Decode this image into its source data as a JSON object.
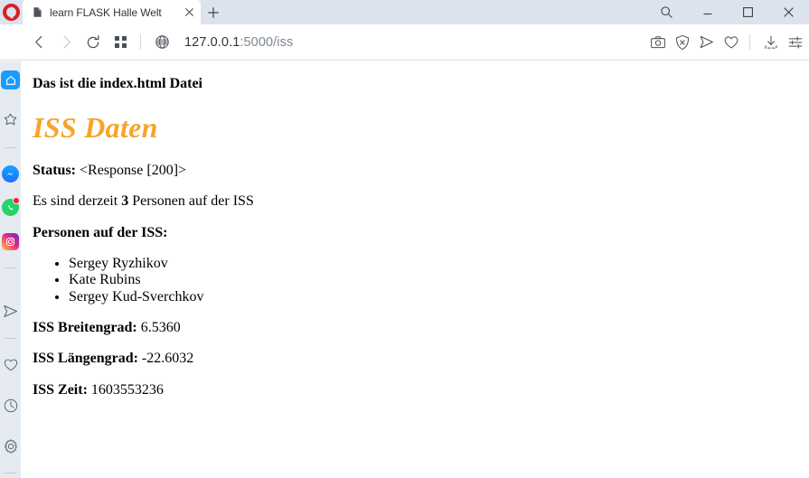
{
  "browser": {
    "logo_name": "opera-logo",
    "tab": {
      "title": "learn FLASK Halle Welt",
      "favicon_name": "page-favicon",
      "close_label": "✕"
    },
    "new_tab_label": "+",
    "window_controls": {
      "search_label": "search-icon",
      "minimize_label": "–",
      "maximize_label": "□",
      "close_label": "✕"
    },
    "toolbar": {
      "back_label": "‹",
      "forward_label": "›",
      "reload_label": "reload-icon",
      "tab_overview_label": "grid-icon",
      "page_icon_label": "globe-icon",
      "url_host": "127.0.0.1",
      "url_rest": ":5000/iss",
      "url_full": "127.0.0.1:5000/iss",
      "right_icons": [
        "camera-icon",
        "ad-block-shield-icon",
        "send-icon",
        "heart-icon",
        "download-icon",
        "easy-setup-icon"
      ]
    },
    "sidebar": {
      "items": [
        {
          "name": "home",
          "label": "Home",
          "icon": "home-icon",
          "active": true
        },
        {
          "name": "favorites",
          "label": "Favorites",
          "icon": "star-icon",
          "active": false
        },
        {
          "name": "messenger",
          "label": "Messenger",
          "icon": "messenger-icon",
          "active": false
        },
        {
          "name": "whatsapp",
          "label": "WhatsApp",
          "icon": "whatsapp-icon",
          "active": false,
          "badge": true
        },
        {
          "name": "instagram",
          "label": "Instagram",
          "icon": "instagram-icon",
          "active": false
        },
        {
          "name": "telegram",
          "label": "Telegram",
          "icon": "send-icon",
          "active": false
        },
        {
          "name": "pinboards",
          "label": "Pinboards",
          "icon": "heart-icon",
          "active": false
        },
        {
          "name": "history",
          "label": "History",
          "icon": "clock-icon",
          "active": false
        },
        {
          "name": "settings",
          "label": "Settings",
          "icon": "gear-icon",
          "active": false
        }
      ]
    },
    "colors": {
      "accent_blue": "#1a9cff",
      "opera_red": "#d81f26",
      "tabstrip_bg": "#dde3ec",
      "sidebar_bg": "#e6ebf2",
      "badge_red": "#f5212d"
    }
  },
  "page": {
    "file_note": "Das ist die index.html Datei",
    "title": "ISS Daten",
    "title_color": "#f7a42a",
    "status_label": "Status:",
    "status_value": "<Response [200]>",
    "count_prefix": "Es sind derzeit",
    "count_value": "3",
    "count_suffix": "Personen auf der ISS",
    "crew_heading": "Personen auf der ISS:",
    "crew": [
      "Sergey Ryzhikov",
      "Kate Rubins",
      "Sergey Kud-Sverchkov"
    ],
    "lat_label": "ISS Breitengrad:",
    "lat_value": "6.5360",
    "lon_label": "ISS Längengrad:",
    "lon_value": "-22.6032",
    "time_label": "ISS Zeit:",
    "time_value": "1603553236"
  }
}
